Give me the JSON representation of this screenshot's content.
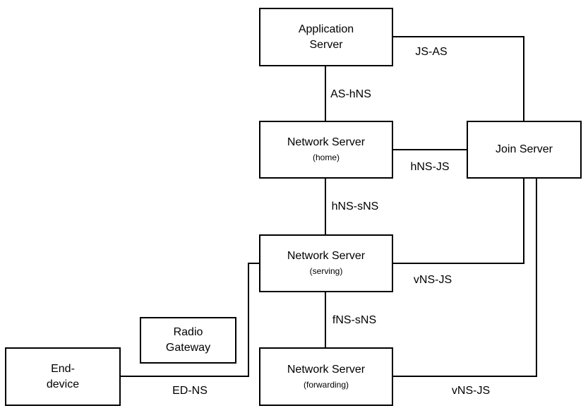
{
  "nodes": {
    "app_server": {
      "line1": "Application",
      "line2": "Server"
    },
    "ns_home": {
      "title": "Network Server",
      "sub": "(home)"
    },
    "join_server": {
      "title": "Join Server"
    },
    "ns_serving": {
      "title": "Network Server",
      "sub": "(serving)"
    },
    "radio_gateway": {
      "line1": "Radio",
      "line2": "Gateway"
    },
    "end_device": {
      "line1": "End-",
      "line2": "device"
    },
    "ns_forwarding": {
      "title": "Network Server",
      "sub": "(forwarding)"
    }
  },
  "links": {
    "js_as": "JS-AS",
    "as_hns": "AS-hNS",
    "hns_js": "hNS-JS",
    "hns_sns": "hNS-sNS",
    "vns_js_serving": "vNS-JS",
    "fns_sns": "fNS-sNS",
    "ed_ns": "ED-NS",
    "vns_js_forwarding": "vNS-JS"
  }
}
